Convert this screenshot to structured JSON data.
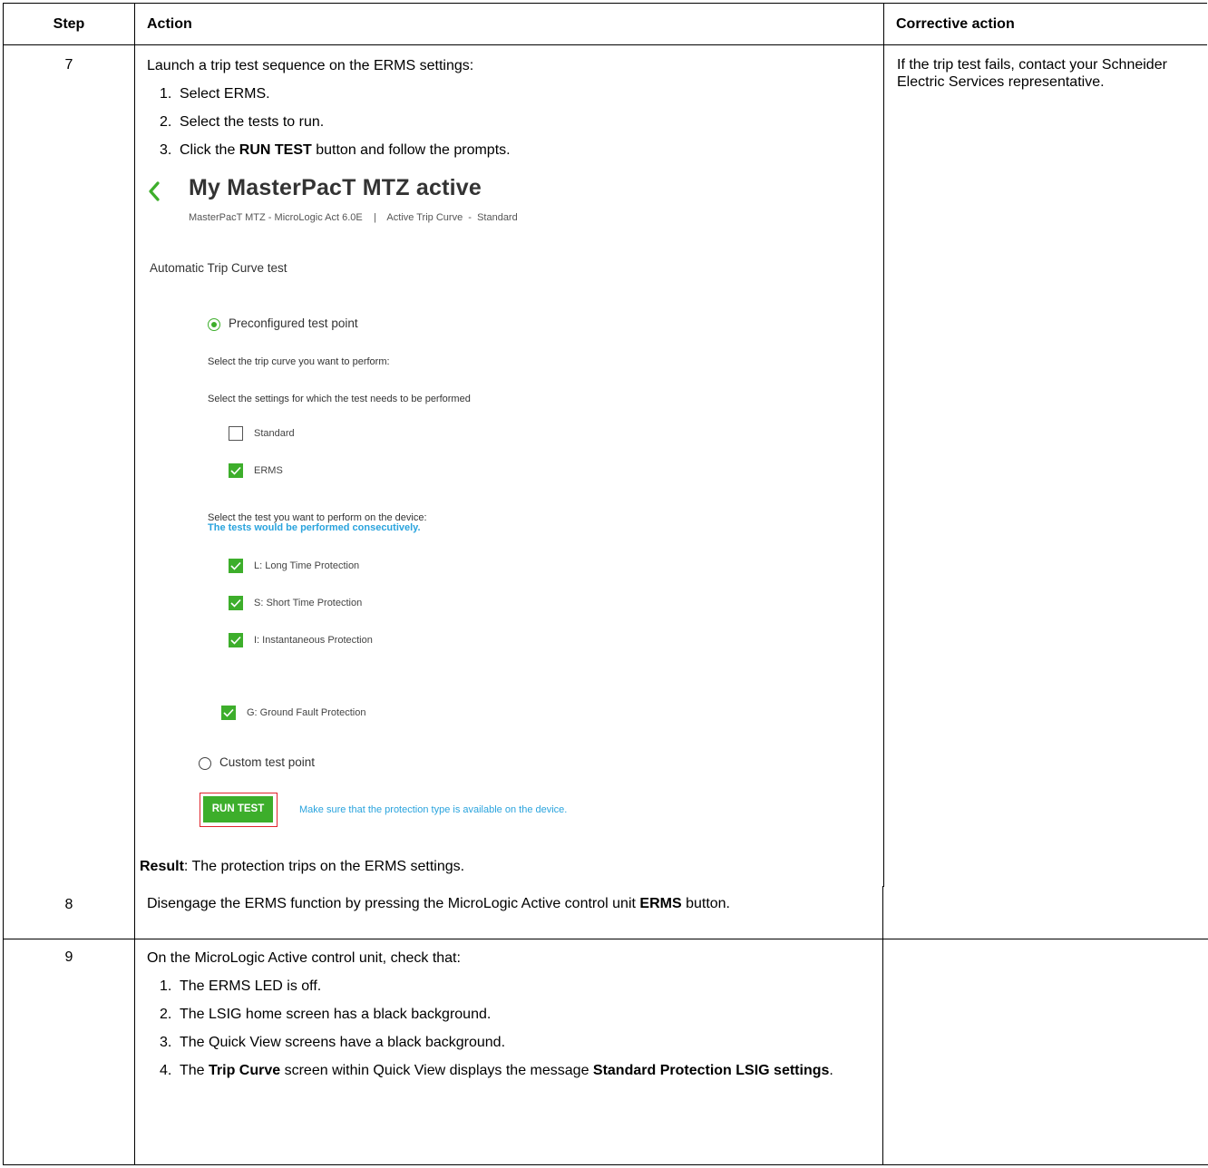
{
  "headers": {
    "step": "Step",
    "action": "Action",
    "corrective": "Corrective action"
  },
  "rows": [
    {
      "step": "7",
      "lead": "Launch a trip test sequence on the ERMS settings:",
      "items": [
        {
          "num": "1.",
          "text": "Select ERMS."
        },
        {
          "num": "2.",
          "text": "Select the tests to run."
        },
        {
          "num": "3.",
          "pre": "Click the ",
          "bold": "RUN TEST",
          "post": " button and follow the prompts."
        }
      ],
      "result_bold": "Result",
      "result_text": ": The protection trips on the ERMS settings.",
      "corrective": "If the trip test fails, contact your Schneider Electric Services representative."
    },
    {
      "step": "8",
      "pre": "Disengage the ERMS function by pressing the MicroLogic Active control unit ",
      "bold": "ERMS",
      "post": " button."
    },
    {
      "step": "9",
      "lead": "On the MicroLogic Active control unit, check that:",
      "items": [
        {
          "num": "1.",
          "text": "The ERMS LED is off."
        },
        {
          "num": "2.",
          "text": "The LSIG home screen has a black background."
        },
        {
          "num": "3.",
          "text": "The Quick View screens have a black background."
        },
        {
          "num": "4.",
          "pre": "The ",
          "bold": "Trip Curve",
          "mid": " screen within Quick View displays the message ",
          "bold2": "Standard Protection LSIG settings",
          "post": "."
        }
      ]
    }
  ],
  "screenshot": {
    "title": "My MasterPacT MTZ active",
    "subtitle": "MasterPacT MTZ - MicroLogic Act 6.0E    |    Active Trip Curve  -  Standard",
    "section": "Automatic Trip Curve test",
    "radio_preconfigured": "Preconfigured test point",
    "select_curve": "Select the trip curve you want to perform:",
    "select_settings": "Select the settings for which the test needs to be performed",
    "cb_standard": "Standard",
    "cb_erms": "ERMS",
    "select_test": "Select the test you want to perform on the device:",
    "consecutive": "The tests would be performed consecutively.",
    "tests": [
      "L: Long Time Protection",
      "S: Short Time Protection",
      "I: Instantaneous Protection",
      "G: Ground Fault Protection"
    ],
    "radio_custom": "Custom test point",
    "run_test": "RUN TEST",
    "note": "Make sure that the protection type is available on the device.",
    "colors": {
      "green": "#3dae2b",
      "blue": "#29a3dd",
      "red": "#e0232b"
    }
  }
}
